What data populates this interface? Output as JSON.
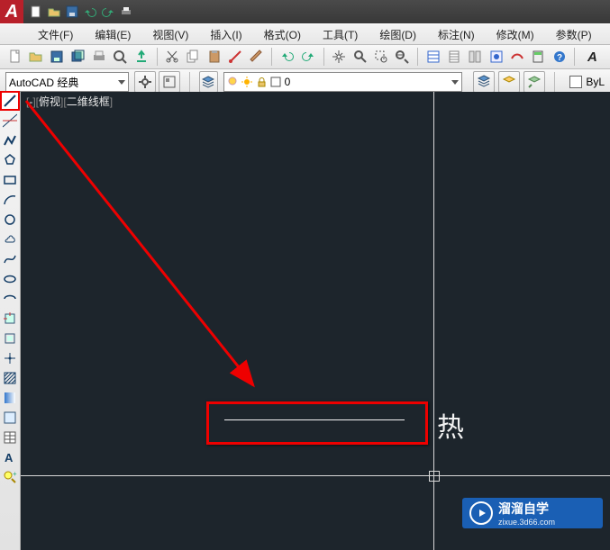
{
  "app": {
    "logo_letter": "A"
  },
  "menu": {
    "file": "文件(F)",
    "edit": "编辑(E)",
    "view": "视图(V)",
    "insert": "插入(I)",
    "format": "格式(O)",
    "tools": "工具(T)",
    "draw": "绘图(D)",
    "dim": "标注(N)",
    "modify": "修改(M)",
    "param": "参数(P)"
  },
  "workspace": {
    "combo_label": "AutoCAD 经典"
  },
  "layer": {
    "current": "0"
  },
  "bylayer": {
    "label": "ByL"
  },
  "viewport": {
    "tag_open": "[",
    "tag_mid1": "-",
    "tag_mid2": "][",
    "top_view": "俯视",
    "tag_mid3": "][",
    "style": "二维线框",
    "tag_close": "]"
  },
  "annotation_text": "热",
  "watermark": {
    "name": "溜溜自学",
    "url": "zixue.3d66.com"
  },
  "left_tools": [
    "line-icon",
    "xline-icon",
    "polyline-icon",
    "polygon-icon",
    "rectangle-icon",
    "arc-icon",
    "circle-icon",
    "revcloud-icon",
    "spline-icon",
    "ellipse-icon",
    "ellipse-arc-icon",
    "insert-block-icon",
    "make-block-icon",
    "point-icon",
    "hatch-icon",
    "gradient-icon",
    "region-icon",
    "table-icon",
    "mtext-icon",
    "addselect-icon"
  ],
  "std_toolbar": [
    "new-icon",
    "open-icon",
    "save-icon",
    "saveas-icon",
    "plot-icon",
    "preview-icon",
    "publish-icon",
    "|",
    "cut-icon",
    "copy-icon",
    "paste-icon",
    "match-icon",
    "brush-icon",
    "|",
    "undo-icon",
    "redo-icon",
    "|",
    "pan-icon",
    "zoom-icon",
    "zoomwin-icon",
    "zoomprev-icon",
    "|",
    "props-icon",
    "sheet-icon",
    "tool-palette-icon",
    "dcenter-icon",
    "markup-icon",
    "calc-icon",
    "help-icon",
    "|",
    "bigtext-icon"
  ],
  "layerbar_icons": [
    "layer-manager-icon",
    "|",
    "bulb-icon",
    "sun-icon",
    "lock-icon",
    "color-icon"
  ],
  "layerbar_right_icons": [
    "layerstate-icon",
    "layeriso-icon",
    "layerprev-icon"
  ],
  "ws_right_icons": [
    "gear-icon",
    "wsswitch-icon"
  ]
}
